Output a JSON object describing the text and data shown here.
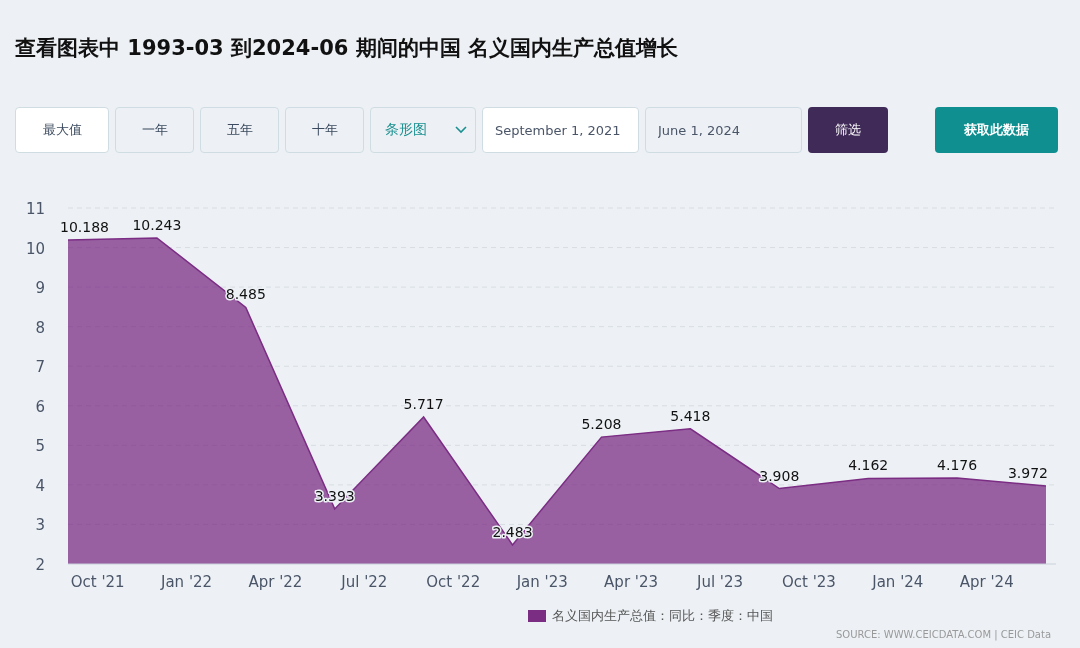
{
  "title": "查看图表中 1993-03 到2024-06 期间的中国 名义国内生产总值增长",
  "range_buttons": [
    {
      "label": "最大值",
      "selected": true
    },
    {
      "label": "一年",
      "selected": false
    },
    {
      "label": "五年",
      "selected": false
    },
    {
      "label": "十年",
      "selected": false
    }
  ],
  "chart_type_select": {
    "value": "条形图"
  },
  "start_date": {
    "value": "September 1, 2021"
  },
  "end_date": {
    "value": "June 1, 2024"
  },
  "filter_button": "筛选",
  "download_button": "获取此数据",
  "chart": {
    "chart_data": {
      "type": "area",
      "grid": true,
      "ylim": [
        2,
        11
      ],
      "data_labels": true,
      "categories": [
        "Oct '21",
        "Jan '22",
        "Apr '22",
        "Jul '22",
        "Oct '22",
        "Jan '23",
        "Apr '23",
        "Jul '23",
        "Oct '23",
        "Jan '24",
        "Apr '24",
        null
      ],
      "series": [
        {
          "name": "名义国内生产总值：同比：季度：中国",
          "color": "#7b2d84",
          "values": [
            10.188,
            10.243,
            8.485,
            3.393,
            5.717,
            2.483,
            5.208,
            5.418,
            3.908,
            4.162,
            4.176,
            3.972
          ]
        }
      ],
      "yticks": [
        2,
        3,
        4,
        5,
        6,
        7,
        8,
        9,
        10,
        11
      ]
    },
    "source": "SOURCE: WWW.CEICDATA.COM | CEIC Data"
  }
}
